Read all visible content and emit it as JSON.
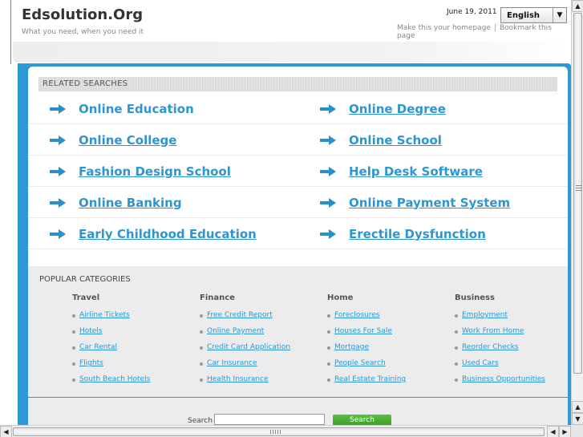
{
  "header": {
    "title": "Edsolution.Org",
    "tagline": "What you need, when you need it",
    "date": "June 19, 2011",
    "language": "English",
    "homepage_link": "Make this your homepage",
    "separator": "|",
    "bookmark_link": "Bookmark this page"
  },
  "related": {
    "heading": "RELATED SEARCHES",
    "items": [
      "Online Education",
      "Online Degree",
      "Online College",
      "Online School",
      "Fashion Design School",
      "Help Desk Software",
      "Online Banking",
      "Online Payment System",
      "Early Childhood Education",
      "Erectile Dysfunction"
    ]
  },
  "popular": {
    "heading": "POPULAR CATEGORIES",
    "columns": [
      {
        "title": "Travel",
        "items": [
          "Airline Tickets",
          "Hotels",
          "Car Rental",
          "Flights",
          "South Beach Hotels"
        ]
      },
      {
        "title": "Finance",
        "items": [
          "Free Credit Report",
          "Online Payment",
          "Credit Card Application",
          "Car Insurance",
          "Health Insurance"
        ]
      },
      {
        "title": "Home",
        "items": [
          "Foreclosures",
          "Houses For Sale",
          "Mortgage",
          "People Search",
          "Real Estate Training"
        ]
      },
      {
        "title": "Business",
        "items": [
          "Employment",
          "Work From Home",
          "Reorder Checks",
          "Used Cars",
          "Business Opportunities"
        ]
      }
    ]
  },
  "search": {
    "label": "Search",
    "button": "Search"
  },
  "scrollbars": {
    "up_arrow": "▲",
    "down_arrow": "▼",
    "left_arrow": "◀",
    "right_arrow": "▶"
  },
  "colors": {
    "frame_blue": "#2d99d5",
    "link_blue": "#2d96d2",
    "category_bg": "#ececec",
    "search_green": "#4aab33"
  }
}
